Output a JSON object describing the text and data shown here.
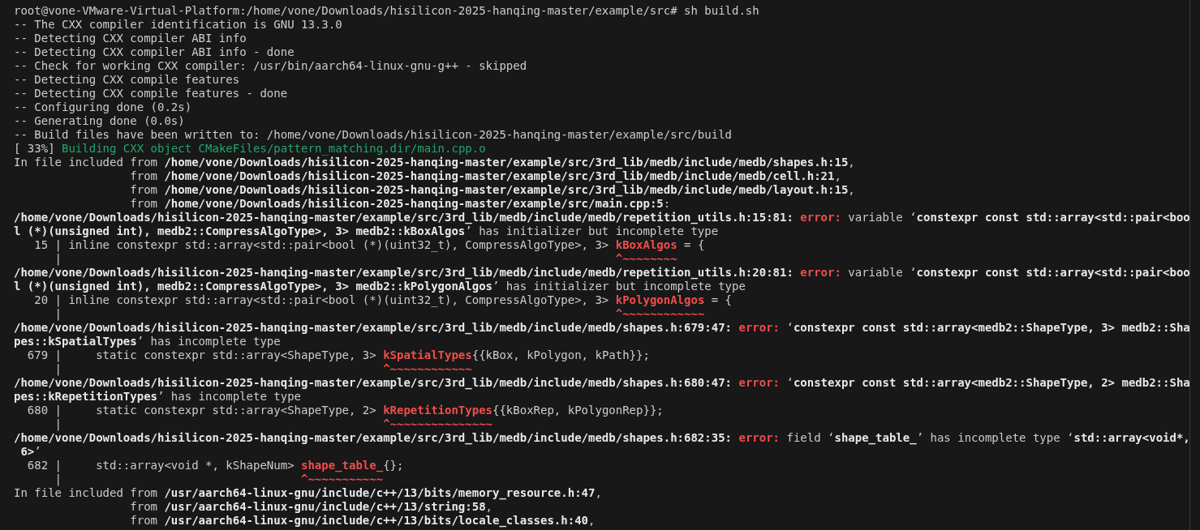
{
  "terminal": {
    "lines": [
      {
        "segments": [
          {
            "kind": "plain",
            "text": "root@vone-VMware-Virtual-Platform:/home/vone/Downloads/hisilicon-2025-hanqing-master/example/src# sh build.sh"
          }
        ]
      },
      {
        "segments": [
          {
            "kind": "plain",
            "text": "-- The CXX compiler identification is GNU 13.3.0"
          }
        ]
      },
      {
        "segments": [
          {
            "kind": "plain",
            "text": "-- Detecting CXX compiler ABI info"
          }
        ]
      },
      {
        "segments": [
          {
            "kind": "plain",
            "text": "-- Detecting CXX compiler ABI info - done"
          }
        ]
      },
      {
        "segments": [
          {
            "kind": "plain",
            "text": "-- Check for working CXX compiler: /usr/bin/aarch64-linux-gnu-g++ - skipped"
          }
        ]
      },
      {
        "segments": [
          {
            "kind": "plain",
            "text": "-- Detecting CXX compile features"
          }
        ]
      },
      {
        "segments": [
          {
            "kind": "plain",
            "text": "-- Detecting CXX compile features - done"
          }
        ]
      },
      {
        "segments": [
          {
            "kind": "plain",
            "text": "-- Configuring done (0.2s)"
          }
        ]
      },
      {
        "segments": [
          {
            "kind": "plain",
            "text": "-- Generating done (0.0s)"
          }
        ]
      },
      {
        "segments": [
          {
            "kind": "plain",
            "text": "-- Build files have been written to: /home/vone/Downloads/hisilicon-2025-hanqing-master/example/src/build"
          }
        ]
      },
      {
        "segments": [
          {
            "kind": "plain",
            "text": "[ 33%] "
          },
          {
            "kind": "green",
            "text": "Building CXX object CMakeFiles/pattern_matching.dir/main.cpp.o"
          }
        ]
      },
      {
        "segments": [
          {
            "kind": "plain",
            "text": "In file included from "
          },
          {
            "kind": "bold",
            "text": "/home/vone/Downloads/hisilicon-2025-hanqing-master/example/src/3rd_lib/medb/include/medb/shapes.h:15"
          },
          {
            "kind": "plain",
            "text": ","
          }
        ]
      },
      {
        "segments": [
          {
            "kind": "plain",
            "text": "                 from "
          },
          {
            "kind": "bold",
            "text": "/home/vone/Downloads/hisilicon-2025-hanqing-master/example/src/3rd_lib/medb/include/medb/cell.h:21"
          },
          {
            "kind": "plain",
            "text": ","
          }
        ]
      },
      {
        "segments": [
          {
            "kind": "plain",
            "text": "                 from "
          },
          {
            "kind": "bold",
            "text": "/home/vone/Downloads/hisilicon-2025-hanqing-master/example/src/3rd_lib/medb/include/medb/layout.h:15"
          },
          {
            "kind": "plain",
            "text": ","
          }
        ]
      },
      {
        "segments": [
          {
            "kind": "plain",
            "text": "                 from "
          },
          {
            "kind": "bold",
            "text": "/home/vone/Downloads/hisilicon-2025-hanqing-master/example/src/main.cpp:5"
          },
          {
            "kind": "plain",
            "text": ":"
          }
        ]
      },
      {
        "segments": [
          {
            "kind": "bold",
            "text": "/home/vone/Downloads/hisilicon-2025-hanqing-master/example/src/3rd_lib/medb/include/medb/repetition_utils.h:15:81: "
          },
          {
            "kind": "error",
            "text": "error:"
          },
          {
            "kind": "plain",
            "text": " variable ‘"
          },
          {
            "kind": "bold",
            "text": "constexpr const std::array<std::pair<boo"
          }
        ]
      },
      {
        "segments": [
          {
            "kind": "bold",
            "text": "l (*)(unsigned int), medb2::CompressAlgoType>, 3> medb2::kBoxAlgos"
          },
          {
            "kind": "plain",
            "text": "’ has initializer but incomplete type"
          }
        ]
      },
      {
        "segments": [
          {
            "kind": "plain",
            "text": "   15 | inline constexpr std::array<std::pair<bool (*)(uint32_t), CompressAlgoType>, 3> "
          },
          {
            "kind": "mark",
            "text": "kBoxAlgos"
          },
          {
            "kind": "plain",
            "text": " = {"
          }
        ]
      },
      {
        "segments": [
          {
            "kind": "plain",
            "text": "      |                                                                                 "
          },
          {
            "kind": "caret",
            "text": "^~~~~~~~~"
          }
        ]
      },
      {
        "segments": [
          {
            "kind": "bold",
            "text": "/home/vone/Downloads/hisilicon-2025-hanqing-master/example/src/3rd_lib/medb/include/medb/repetition_utils.h:20:81: "
          },
          {
            "kind": "error",
            "text": "error:"
          },
          {
            "kind": "plain",
            "text": " variable ‘"
          },
          {
            "kind": "bold",
            "text": "constexpr const std::array<std::pair<boo"
          }
        ]
      },
      {
        "segments": [
          {
            "kind": "bold",
            "text": "l (*)(unsigned int), medb2::CompressAlgoType>, 3> medb2::kPolygonAlgos"
          },
          {
            "kind": "plain",
            "text": "’ has initializer but incomplete type"
          }
        ]
      },
      {
        "segments": [
          {
            "kind": "plain",
            "text": "   20 | inline constexpr std::array<std::pair<bool (*)(uint32_t), CompressAlgoType>, 3> "
          },
          {
            "kind": "mark",
            "text": "kPolygonAlgos"
          },
          {
            "kind": "plain",
            "text": " = {"
          }
        ]
      },
      {
        "segments": [
          {
            "kind": "plain",
            "text": "      |                                                                                 "
          },
          {
            "kind": "caret",
            "text": "^~~~~~~~~~~~~"
          }
        ]
      },
      {
        "segments": [
          {
            "kind": "bold",
            "text": "/home/vone/Downloads/hisilicon-2025-hanqing-master/example/src/3rd_lib/medb/include/medb/shapes.h:679:47: "
          },
          {
            "kind": "error",
            "text": "error:"
          },
          {
            "kind": "plain",
            "text": " ‘"
          },
          {
            "kind": "bold",
            "text": "constexpr const std::array<medb2::ShapeType, 3> medb2::Sha"
          }
        ]
      },
      {
        "segments": [
          {
            "kind": "bold",
            "text": "pes::kSpatialTypes"
          },
          {
            "kind": "plain",
            "text": "’ has incomplete type"
          }
        ]
      },
      {
        "segments": [
          {
            "kind": "plain",
            "text": "  679 |     static constexpr std::array<ShapeType, 3> "
          },
          {
            "kind": "mark",
            "text": "kSpatialTypes"
          },
          {
            "kind": "plain",
            "text": "{{kBox, kPolygon, kPath}};"
          }
        ]
      },
      {
        "segments": [
          {
            "kind": "plain",
            "text": "      |                                               "
          },
          {
            "kind": "caret",
            "text": "^~~~~~~~~~~~~"
          }
        ]
      },
      {
        "segments": [
          {
            "kind": "bold",
            "text": "/home/vone/Downloads/hisilicon-2025-hanqing-master/example/src/3rd_lib/medb/include/medb/shapes.h:680:47: "
          },
          {
            "kind": "error",
            "text": "error:"
          },
          {
            "kind": "plain",
            "text": " ‘"
          },
          {
            "kind": "bold",
            "text": "constexpr const std::array<medb2::ShapeType, 2> medb2::Sha"
          }
        ]
      },
      {
        "segments": [
          {
            "kind": "bold",
            "text": "pes::kRepetitionTypes"
          },
          {
            "kind": "plain",
            "text": "’ has incomplete type"
          }
        ]
      },
      {
        "segments": [
          {
            "kind": "plain",
            "text": "  680 |     static constexpr std::array<ShapeType, 2> "
          },
          {
            "kind": "mark",
            "text": "kRepetitionTypes"
          },
          {
            "kind": "plain",
            "text": "{{kBoxRep, kPolygonRep}};"
          }
        ]
      },
      {
        "segments": [
          {
            "kind": "plain",
            "text": "      |                                               "
          },
          {
            "kind": "caret",
            "text": "^~~~~~~~~~~~~~~~"
          }
        ]
      },
      {
        "segments": [
          {
            "kind": "bold",
            "text": "/home/vone/Downloads/hisilicon-2025-hanqing-master/example/src/3rd_lib/medb/include/medb/shapes.h:682:35: "
          },
          {
            "kind": "error",
            "text": "error:"
          },
          {
            "kind": "plain",
            "text": " field ‘"
          },
          {
            "kind": "bold",
            "text": "shape_table_"
          },
          {
            "kind": "plain",
            "text": "’ has incomplete type ‘"
          },
          {
            "kind": "bold",
            "text": "std::array<void*,"
          }
        ]
      },
      {
        "segments": [
          {
            "kind": "bold",
            "text": " 6>"
          },
          {
            "kind": "plain",
            "text": "’"
          }
        ]
      },
      {
        "segments": [
          {
            "kind": "plain",
            "text": "  682 |     std::array<void *, kShapeNum> "
          },
          {
            "kind": "mark",
            "text": "shape_table_"
          },
          {
            "kind": "plain",
            "text": "{};"
          }
        ]
      },
      {
        "segments": [
          {
            "kind": "plain",
            "text": "      |                                   "
          },
          {
            "kind": "caret",
            "text": "^~~~~~~~~~~~"
          }
        ]
      },
      {
        "segments": [
          {
            "kind": "plain",
            "text": "In file included from "
          },
          {
            "kind": "bold",
            "text": "/usr/aarch64-linux-gnu/include/c++/13/bits/memory_resource.h:47"
          },
          {
            "kind": "plain",
            "text": ","
          }
        ]
      },
      {
        "segments": [
          {
            "kind": "plain",
            "text": "                 from "
          },
          {
            "kind": "bold",
            "text": "/usr/aarch64-linux-gnu/include/c++/13/string:58"
          },
          {
            "kind": "plain",
            "text": ","
          }
        ]
      },
      {
        "segments": [
          {
            "kind": "plain",
            "text": "                 from "
          },
          {
            "kind": "bold",
            "text": "/usr/aarch64-linux-gnu/include/c++/13/bits/locale_classes.h:40"
          },
          {
            "kind": "plain",
            "text": ","
          }
        ]
      }
    ]
  }
}
